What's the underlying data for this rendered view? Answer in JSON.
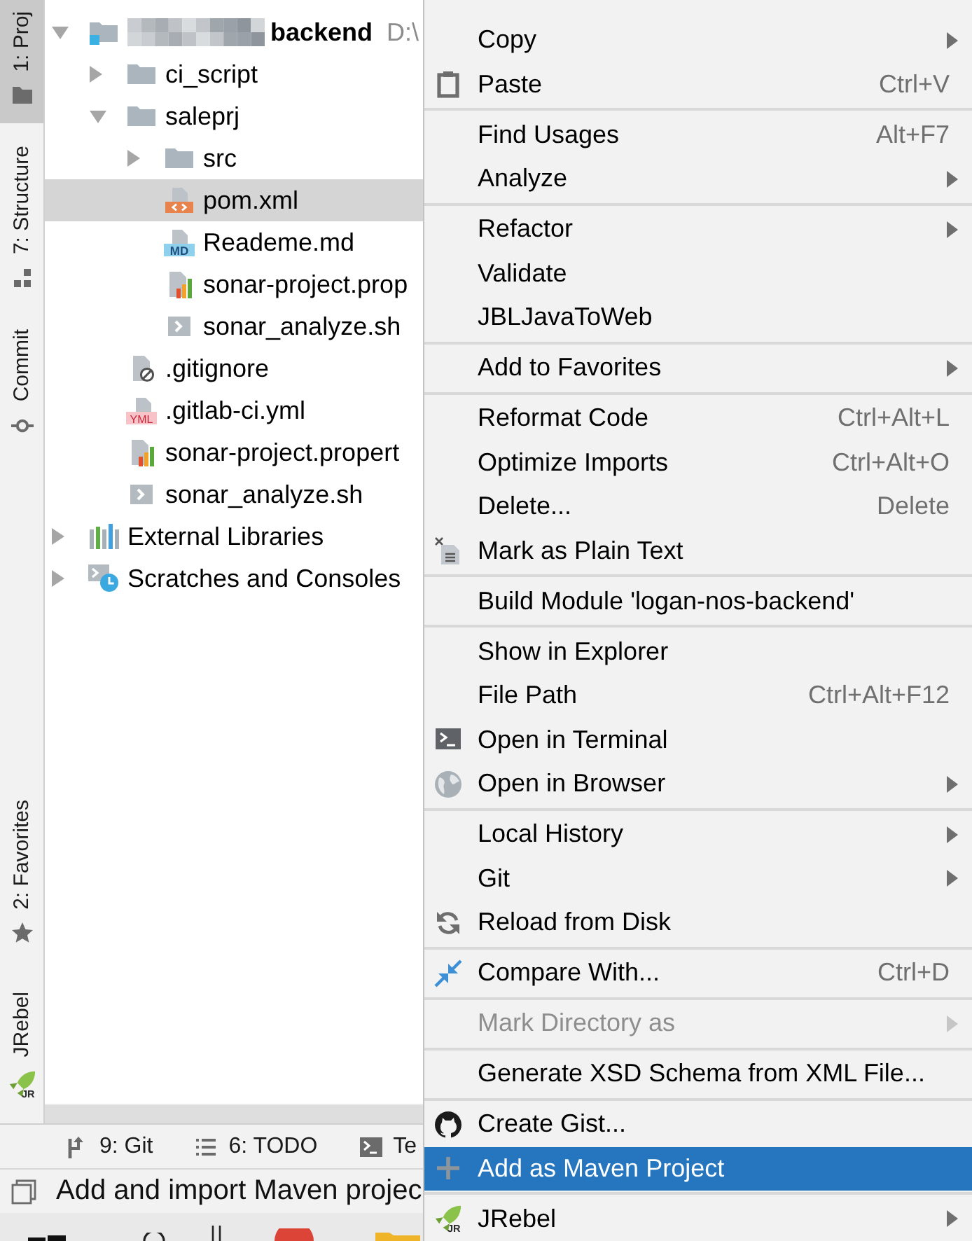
{
  "left_toolbar": {
    "top": [
      {
        "label": "1: Proj",
        "selected": true
      },
      {
        "label": "7: Structure",
        "selected": false
      },
      {
        "label": "Commit",
        "selected": false
      }
    ],
    "bottom": [
      {
        "label": "2: Favorites",
        "selected": false
      },
      {
        "label": "JRebel",
        "badge": "JR",
        "selected": false
      }
    ]
  },
  "project_tree": {
    "nodes": [
      {
        "kind": "module",
        "name": "backend",
        "name_redacted": true,
        "path": "D:\\",
        "expanded": true,
        "selected": false,
        "children": [
          {
            "kind": "folder",
            "name": "ci_script",
            "expanded": false,
            "selected": false
          },
          {
            "kind": "folder",
            "name": "saleprj",
            "expanded": true,
            "selected": false,
            "children": [
              {
                "kind": "folder",
                "name": "src",
                "expanded": false,
                "selected": false
              },
              {
                "kind": "xml",
                "name": "pom.xml",
                "selected": true
              },
              {
                "kind": "markdown",
                "name": "Reademe.md",
                "badge": "MD",
                "selected": false
              },
              {
                "kind": "properties",
                "name": "sonar-project.prop",
                "selected": false
              },
              {
                "kind": "shell",
                "name": "sonar_analyze.sh",
                "selected": false
              }
            ]
          },
          {
            "kind": "ignore",
            "name": ".gitignore",
            "selected": false
          },
          {
            "kind": "yaml",
            "name": ".gitlab-ci.yml",
            "badge": "YML",
            "selected": false
          },
          {
            "kind": "properties",
            "name": "sonar-project.propert",
            "selected": false
          },
          {
            "kind": "shell",
            "name": "sonar_analyze.sh",
            "selected": false
          }
        ]
      },
      {
        "kind": "libraries",
        "name": "External Libraries",
        "expanded": false,
        "selected": false
      },
      {
        "kind": "scratches",
        "name": "Scratches and Consoles",
        "expanded": false,
        "selected": false
      }
    ]
  },
  "bottom_toolbar": {
    "tabs": [
      {
        "label": "9: Git"
      },
      {
        "label": "6: TODO"
      },
      {
        "label": "Te"
      }
    ]
  },
  "status_bar": {
    "message": "Add and import Maven projec"
  },
  "context_menu": {
    "groups": [
      {
        "items": [
          {
            "label": "Copy",
            "submenu": true,
            "selected": false,
            "disabled": false
          },
          {
            "label": "Paste",
            "shortcut": "Ctrl+V",
            "submenu": false,
            "selected": false,
            "disabled": false
          }
        ]
      },
      {
        "items": [
          {
            "label": "Find Usages",
            "shortcut": "Alt+F7",
            "submenu": false,
            "selected": false,
            "disabled": false
          },
          {
            "label": "Analyze",
            "submenu": true,
            "selected": false,
            "disabled": false
          }
        ]
      },
      {
        "items": [
          {
            "label": "Refactor",
            "submenu": true,
            "selected": false,
            "disabled": false
          },
          {
            "label": "Validate",
            "submenu": false,
            "selected": false,
            "disabled": false
          },
          {
            "label": "JBLJavaToWeb",
            "submenu": false,
            "selected": false,
            "disabled": false
          }
        ]
      },
      {
        "items": [
          {
            "label": "Add to Favorites",
            "submenu": true,
            "selected": false,
            "disabled": false
          }
        ]
      },
      {
        "items": [
          {
            "label": "Reformat Code",
            "shortcut": "Ctrl+Alt+L",
            "submenu": false,
            "selected": false,
            "disabled": false
          },
          {
            "label": "Optimize Imports",
            "shortcut": "Ctrl+Alt+O",
            "submenu": false,
            "selected": false,
            "disabled": false
          },
          {
            "label": "Delete...",
            "shortcut": "Delete",
            "submenu": false,
            "selected": false,
            "disabled": false
          },
          {
            "label": "Mark as Plain Text",
            "submenu": false,
            "selected": false,
            "disabled": false
          }
        ]
      },
      {
        "items": [
          {
            "label": "Build Module 'logan-nos-backend'",
            "submenu": false,
            "selected": false,
            "disabled": false
          }
        ]
      },
      {
        "items": [
          {
            "label": "Show in Explorer",
            "submenu": false,
            "selected": false,
            "disabled": false
          },
          {
            "label": "File Path",
            "shortcut": "Ctrl+Alt+F12",
            "submenu": false,
            "selected": false,
            "disabled": false
          },
          {
            "label": "Open in Terminal",
            "submenu": false,
            "selected": false,
            "disabled": false
          },
          {
            "label": "Open in Browser",
            "submenu": true,
            "selected": false,
            "disabled": false
          }
        ]
      },
      {
        "items": [
          {
            "label": "Local History",
            "submenu": true,
            "selected": false,
            "disabled": false
          },
          {
            "label": "Git",
            "submenu": true,
            "selected": false,
            "disabled": false
          },
          {
            "label": "Reload from Disk",
            "submenu": false,
            "selected": false,
            "disabled": false
          }
        ]
      },
      {
        "items": [
          {
            "label": "Compare With...",
            "shortcut": "Ctrl+D",
            "submenu": false,
            "selected": false,
            "disabled": false
          }
        ]
      },
      {
        "items": [
          {
            "label": "Mark Directory as",
            "submenu": true,
            "selected": false,
            "disabled": true
          }
        ]
      },
      {
        "items": [
          {
            "label": "Generate XSD Schema from XML File...",
            "submenu": false,
            "selected": false,
            "disabled": false
          }
        ]
      },
      {
        "items": [
          {
            "label": "Create Gist...",
            "submenu": false,
            "selected": false,
            "disabled": false
          },
          {
            "label": "Add as Maven Project",
            "submenu": false,
            "selected": true,
            "disabled": false
          }
        ]
      },
      {
        "items": [
          {
            "label": "JRebel",
            "badge": "JR",
            "submenu": true,
            "selected": false,
            "disabled": false
          }
        ]
      }
    ]
  }
}
